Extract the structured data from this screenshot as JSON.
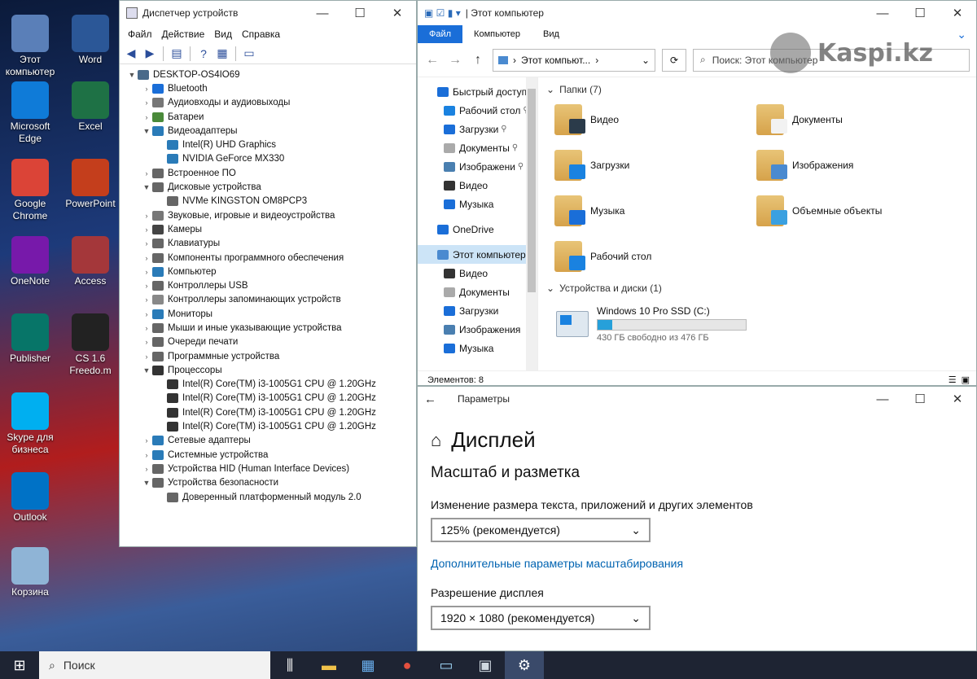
{
  "desktop": {
    "icons": [
      {
        "label": "Этот компьютер",
        "icon": "this-pc-icon",
        "color": "#5a7fb8"
      },
      {
        "label": "Word",
        "icon": "word-icon",
        "color": "#2b5797"
      },
      {
        "label": "Microsoft Edge",
        "icon": "edge-icon",
        "color": "#0f7bd8"
      },
      {
        "label": "Excel",
        "icon": "excel-icon",
        "color": "#1e7145"
      },
      {
        "label": "Google Chrome",
        "icon": "chrome-icon",
        "color": "#db4437"
      },
      {
        "label": "PowerPoint",
        "icon": "powerpoint-icon",
        "color": "#c43e1c"
      },
      {
        "label": "OneNote",
        "icon": "onenote-icon",
        "color": "#7719aa"
      },
      {
        "label": "Access",
        "icon": "access-icon",
        "color": "#a4373a"
      },
      {
        "label": "Publisher",
        "icon": "publisher-icon",
        "color": "#077568"
      },
      {
        "label": "CS 1.6 Freedo.m",
        "icon": "cs-icon",
        "color": "#222222"
      },
      {
        "label": "Skype для бизнеса",
        "icon": "skype-icon",
        "color": "#00aff0"
      },
      {
        "label": "Outlook",
        "icon": "outlook-icon",
        "color": "#0072c6"
      },
      {
        "label": "Корзина",
        "icon": "recycle-bin-icon",
        "color": "#8fb4d6"
      }
    ]
  },
  "devmgr": {
    "title": "Диспетчер устройств",
    "menu": [
      "Файл",
      "Действие",
      "Вид",
      "Справка"
    ],
    "root": "DESKTOP-OS4IO69",
    "tree": [
      {
        "label": "Bluetooth",
        "expanded": false,
        "color": "#1a6ed8"
      },
      {
        "label": "Аудиовходы и аудиовыходы",
        "expanded": false,
        "color": "#777"
      },
      {
        "label": "Батареи",
        "expanded": false,
        "color": "#4a8a3a"
      },
      {
        "label": "Видеоадаптеры",
        "expanded": true,
        "color": "#2a7bb8",
        "children": [
          "Intel(R) UHD Graphics",
          "NVIDIA GeForce MX330"
        ]
      },
      {
        "label": "Встроенное ПО",
        "expanded": false,
        "color": "#666"
      },
      {
        "label": "Дисковые устройства",
        "expanded": true,
        "color": "#666",
        "children": [
          "NVMe KINGSTON OM8PCP3"
        ]
      },
      {
        "label": "Звуковые, игровые и видеоустройства",
        "expanded": false,
        "color": "#777"
      },
      {
        "label": "Камеры",
        "expanded": false,
        "color": "#444"
      },
      {
        "label": "Клавиатуры",
        "expanded": false,
        "color": "#666"
      },
      {
        "label": "Компоненты программного обеспечения",
        "expanded": false,
        "color": "#666"
      },
      {
        "label": "Компьютер",
        "expanded": false,
        "color": "#2a7bb8"
      },
      {
        "label": "Контроллеры USB",
        "expanded": false,
        "color": "#666"
      },
      {
        "label": "Контроллеры запоминающих устройств",
        "expanded": false,
        "color": "#888"
      },
      {
        "label": "Мониторы",
        "expanded": false,
        "color": "#2a7bb8"
      },
      {
        "label": "Мыши и иные указывающие устройства",
        "expanded": false,
        "color": "#666"
      },
      {
        "label": "Очереди печати",
        "expanded": false,
        "color": "#666"
      },
      {
        "label": "Программные устройства",
        "expanded": false,
        "color": "#666"
      },
      {
        "label": "Процессоры",
        "expanded": true,
        "color": "#333",
        "children": [
          "Intel(R) Core(TM) i3-1005G1 CPU @ 1.20GHz",
          "Intel(R) Core(TM) i3-1005G1 CPU @ 1.20GHz",
          "Intel(R) Core(TM) i3-1005G1 CPU @ 1.20GHz",
          "Intel(R) Core(TM) i3-1005G1 CPU @ 1.20GHz"
        ]
      },
      {
        "label": "Сетевые адаптеры",
        "expanded": false,
        "color": "#2a7bb8"
      },
      {
        "label": "Системные устройства",
        "expanded": false,
        "color": "#2a7bb8"
      },
      {
        "label": "Устройства HID (Human Interface Devices)",
        "expanded": false,
        "color": "#666"
      },
      {
        "label": "Устройства безопасности",
        "expanded": true,
        "color": "#666",
        "children": [
          "Доверенный платформенный модуль 2.0"
        ]
      }
    ]
  },
  "explorer": {
    "title": "Этот компьютер",
    "tabs": [
      "Файл",
      "Компьютер",
      "Вид"
    ],
    "address": "Этот компьют...",
    "search_placeholder": "Поиск: Этот компьютер",
    "nav": [
      {
        "label": "Быстрый доступ",
        "icon": "star-icon",
        "color": "#1a6ed8",
        "pinned": false,
        "indent": 0
      },
      {
        "label": "Рабочий стол",
        "icon": "desktop-folder-icon",
        "color": "#1a82e0",
        "pinned": true,
        "indent": 1
      },
      {
        "label": "Загрузки",
        "icon": "downloads-icon",
        "color": "#1a6ed8",
        "pinned": true,
        "indent": 1
      },
      {
        "label": "Документы",
        "icon": "documents-icon",
        "color": "#aaa",
        "pinned": true,
        "indent": 1
      },
      {
        "label": "Изображени",
        "icon": "pictures-icon",
        "color": "#4a7fb0",
        "pinned": true,
        "indent": 1
      },
      {
        "label": "Видео",
        "icon": "video-icon",
        "color": "#333",
        "pinned": false,
        "indent": 1
      },
      {
        "label": "Музыка",
        "icon": "music-icon",
        "color": "#1a6ed8",
        "pinned": false,
        "indent": 1
      },
      {
        "label": "OneDrive",
        "icon": "onedrive-icon",
        "color": "#1a6ed8",
        "pinned": false,
        "indent": 0
      },
      {
        "label": "Этот компьютер",
        "icon": "this-pc-icon",
        "color": "#4a8ad0",
        "pinned": false,
        "indent": 0,
        "selected": true
      },
      {
        "label": "Видео",
        "icon": "video-icon",
        "color": "#333",
        "pinned": false,
        "indent": 1
      },
      {
        "label": "Документы",
        "icon": "documents-icon",
        "color": "#aaa",
        "pinned": false,
        "indent": 1
      },
      {
        "label": "Загрузки",
        "icon": "downloads-icon",
        "color": "#1a6ed8",
        "pinned": false,
        "indent": 1
      },
      {
        "label": "Изображения",
        "icon": "pictures-icon",
        "color": "#4a7fb0",
        "pinned": false,
        "indent": 1
      },
      {
        "label": "Музыка",
        "icon": "music-icon",
        "color": "#1a6ed8",
        "pinned": false,
        "indent": 1
      }
    ],
    "folders_header": "Папки (7)",
    "folders": [
      {
        "label": "Видео",
        "badge": "#2b3b4a"
      },
      {
        "label": "Документы",
        "badge": "#f2f2f2"
      },
      {
        "label": "Загрузки",
        "badge": "#1a82e0"
      },
      {
        "label": "Изображения",
        "badge": "#4a8ad0"
      },
      {
        "label": "Музыка",
        "badge": "#1a6ed8"
      },
      {
        "label": "Объемные объекты",
        "badge": "#3aa0e0"
      },
      {
        "label": "Рабочий стол",
        "badge": "#1a82e0"
      }
    ],
    "drives_header": "Устройства и диски (1)",
    "drive": {
      "name": "Windows 10 Pro SSD (C:)",
      "free": "430 ГБ свободно из 476 ГБ",
      "used_fraction": 0.097
    },
    "status": "Элементов: 8"
  },
  "settings": {
    "title": "Параметры",
    "heading": "Дисплей",
    "section": "Масштаб и разметка",
    "scale_label": "Изменение размера текста, приложений и других элементов",
    "scale_value": "125% (рекомендуется)",
    "advanced_link": "Дополнительные параметры масштабирования",
    "resolution_label": "Разрешение дисплея",
    "resolution_value": "1920 × 1080 (рекомендуется)"
  },
  "taskbar": {
    "search_placeholder": "Поиск",
    "apps": [
      "task-view-icon",
      "file-explorer-icon",
      "store-icon",
      "chrome-icon",
      "device-manager-icon",
      "network-icon",
      "settings-icon"
    ]
  },
  "watermark": "Kaspi.kz"
}
